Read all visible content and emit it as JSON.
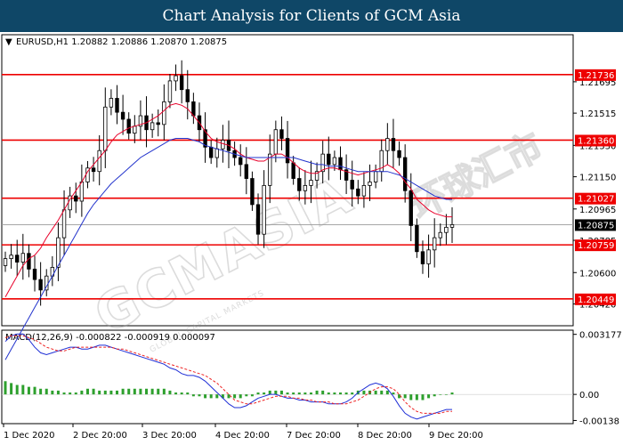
{
  "banner": {
    "title": "Chart Analysis for Clients of GCM Asia",
    "bg_color": "#0f4767"
  },
  "watermark": {
    "text": "GCMASIA",
    "cn_text": "环球汇市",
    "small": "GLOBAL CAPITAL MARKETS"
  },
  "chart_data": {
    "type": "candlestick",
    "symbol_header": "EURUSD,H1  1.20882 1.20886 1.20870 1.20875",
    "price_axis": {
      "range": [
        1.203,
        1.2196
      ],
      "ticks": [
        "1.21695",
        "1.21515",
        "1.21330",
        "1.21150",
        "1.20965",
        "1.20785",
        "1.20600",
        "1.20420"
      ],
      "tick_values": [
        1.21695,
        1.21515,
        1.2133,
        1.2115,
        1.20965,
        1.20785,
        1.206,
        1.2042
      ]
    },
    "x_axis_labels": [
      "1 Dec 2020",
      "2 Dec 20:00",
      "3 Dec 20:00",
      "4 Dec 20:00",
      "7 Dec 20:00",
      "8 Dec 20:00",
      "9 Dec 20:00"
    ],
    "current_price": {
      "value": 1.20875,
      "label": "1.20875"
    },
    "levels": [
      {
        "value": 1.21736,
        "label": "1.21736"
      },
      {
        "value": 1.2136,
        "label": "1.21360"
      },
      {
        "value": 1.21027,
        "label": "1.21027"
      },
      {
        "value": 1.20759,
        "label": "1.20759"
      },
      {
        "value": 1.20449,
        "label": "1.20449"
      }
    ],
    "closes": [
      1.2068,
      1.207,
      1.2066,
      1.2071,
      1.2062,
      1.2056,
      1.205,
      1.2058,
      1.2063,
      1.208,
      1.2096,
      1.2104,
      1.2101,
      1.2112,
      1.212,
      1.2118,
      1.213,
      1.2155,
      1.216,
      1.2152,
      1.2148,
      1.214,
      1.2144,
      1.215,
      1.2142,
      1.2146,
      1.2145,
      1.2158,
      1.217,
      1.2173,
      1.2165,
      1.2158,
      1.215,
      1.2142,
      1.2132,
      1.2126,
      1.2131,
      1.2136,
      1.213,
      1.2126,
      1.2122,
      1.2114,
      1.2099,
      1.2082,
      1.211,
      1.2128,
      1.2142,
      1.2137,
      1.2123,
      1.2114,
      1.2107,
      1.211,
      1.2113,
      1.2118,
      1.2128,
      1.2122,
      1.2126,
      1.2119,
      1.2113,
      1.2108,
      1.2104,
      1.211,
      1.2112,
      1.2118,
      1.213,
      1.2137,
      1.213,
      1.2126,
      1.2107,
      1.2087,
      1.2072,
      1.2065,
      1.2073,
      1.208,
      1.2083,
      1.2086,
      1.20875
    ],
    "sma_red": [
      1.2046,
      1.2052,
      1.2058,
      1.2064,
      1.2068,
      1.207,
      1.2074,
      1.208,
      1.2085,
      1.209,
      1.2096,
      1.2102,
      1.2107,
      1.2112,
      1.2118,
      1.2122,
      1.2126,
      1.213,
      1.2135,
      1.2139,
      1.2141,
      1.2143,
      1.2144,
      1.2145,
      1.2146,
      1.2148,
      1.215,
      1.2153,
      1.2156,
      1.2157,
      1.2156,
      1.2154,
      1.215,
      1.2146,
      1.2141,
      1.2137,
      1.2135,
      1.2134,
      1.2133,
      1.2131,
      1.2128,
      1.2126,
      1.2125,
      1.2124,
      1.2124,
      1.2126,
      1.2128,
      1.2128,
      1.2126,
      1.2123,
      1.212,
      1.2118,
      1.2117,
      1.2117,
      1.2119,
      1.212,
      1.212,
      1.2119,
      1.2118,
      1.2117,
      1.2116,
      1.2117,
      1.2118,
      1.2119,
      1.212,
      1.2122,
      1.212,
      1.2117,
      1.2112,
      1.2108,
      1.2102,
      1.2099,
      1.2096,
      1.2094,
      1.2093,
      1.2092,
      1.2092
    ],
    "sma_blue": [
      1.201,
      1.2016,
      1.2022,
      1.2028,
      1.2034,
      1.204,
      1.2046,
      1.2052,
      1.2058,
      1.2064,
      1.207,
      1.2076,
      1.2082,
      1.2088,
      1.2094,
      1.2099,
      1.2103,
      1.2107,
      1.2111,
      1.2114,
      1.2117,
      1.212,
      1.2123,
      1.2126,
      1.2128,
      1.213,
      1.2132,
      1.2134,
      1.2136,
      1.2137,
      1.2137,
      1.2137,
      1.2136,
      1.2135,
      1.2133,
      1.2132,
      1.2131,
      1.213,
      1.2129,
      1.2128,
      1.2127,
      1.2126,
      1.2126,
      1.2126,
      1.2126,
      1.2126,
      1.2126,
      1.2126,
      1.2126,
      1.2126,
      1.2125,
      1.2124,
      1.2123,
      1.2122,
      1.2122,
      1.2121,
      1.2121,
      1.2121,
      1.212,
      1.2119,
      1.2118,
      1.2118,
      1.2118,
      1.2118,
      1.2118,
      1.2118,
      1.2117,
      1.2116,
      1.2114,
      1.2112,
      1.211,
      1.2108,
      1.2106,
      1.2104,
      1.2103,
      1.2102,
      1.2102
    ],
    "macd": {
      "header": "MACD(12,26,9) -0.000822 -0.000919 0.000097",
      "range": [
        -0.0015,
        0.00335
      ],
      "ticks": [
        "0.003177",
        "0.00",
        "-0.00138"
      ],
      "tick_values": [
        0.003177,
        0.0,
        -0.00138
      ],
      "main": [
        0.0028,
        0.0031,
        0.0032,
        0.0032,
        0.0029,
        0.0025,
        0.0022,
        0.0021,
        0.0022,
        0.0023,
        0.0024,
        0.0025,
        0.0025,
        0.0024,
        0.0024,
        0.0025,
        0.0026,
        0.0026,
        0.0025,
        0.0024,
        0.0023,
        0.0022,
        0.0021,
        0.002,
        0.0019,
        0.0018,
        0.0017,
        0.0016,
        0.0014,
        0.0013,
        0.0011,
        0.001,
        0.001,
        0.0009,
        0.0007,
        0.0004,
        0.0001,
        -0.0002,
        -0.0005,
        -0.0007,
        -0.0007,
        -0.0006,
        -0.0004,
        -0.0002,
        -0.0001,
        0.0,
        0.0,
        -0.0001,
        -0.0002,
        -0.0002,
        -0.0003,
        -0.0003,
        -0.0004,
        -0.0004,
        -0.0004,
        -0.0005,
        -0.0005,
        -0.0005,
        -0.0004,
        -0.0002,
        0.0001,
        0.0003,
        0.0005,
        0.0006,
        0.0005,
        0.0003,
        -0.0001,
        -0.0006,
        -0.001,
        -0.0012,
        -0.0013,
        -0.0012,
        -0.0011,
        -0.001,
        -0.0009,
        -0.0008,
        -0.0008
      ],
      "signal": [
        0.003,
        0.0031,
        0.0031,
        0.0031,
        0.003,
        0.0029,
        0.0027,
        0.0025,
        0.0024,
        0.0023,
        0.0023,
        0.0024,
        0.0025,
        0.0025,
        0.0025,
        0.0025,
        0.0025,
        0.0025,
        0.0025,
        0.0024,
        0.0024,
        0.0023,
        0.0022,
        0.0021,
        0.002,
        0.0019,
        0.0018,
        0.0017,
        0.0016,
        0.0015,
        0.0014,
        0.0013,
        0.0012,
        0.0011,
        0.001,
        0.0008,
        0.0006,
        0.0003,
        0.0,
        -0.0003,
        -0.0004,
        -0.0005,
        -0.0005,
        -0.0004,
        -0.0003,
        -0.0002,
        -0.0001,
        -0.0001,
        -0.0001,
        -0.0002,
        -0.0002,
        -0.0003,
        -0.0003,
        -0.0004,
        -0.0004,
        -0.0004,
        -0.0005,
        -0.0005,
        -0.0005,
        -0.0004,
        -0.0003,
        -0.0001,
        0.0001,
        0.0003,
        0.0004,
        0.0004,
        0.0003,
        0.0,
        -0.0004,
        -0.0007,
        -0.0009,
        -0.001,
        -0.001,
        -0.001,
        -0.001,
        -0.0009,
        -0.0009
      ],
      "histogram": [
        0.0007,
        0.0006,
        0.0005,
        0.0005,
        0.0004,
        0.0004,
        0.0003,
        0.0003,
        0.0002,
        0.0002,
        0.0001,
        0.0001,
        0.0001,
        0.0002,
        0.0003,
        0.0003,
        0.0002,
        0.0002,
        0.0002,
        0.0002,
        0.0003,
        0.0003,
        0.0003,
        0.0003,
        0.0003,
        0.0003,
        0.0003,
        0.0003,
        0.0002,
        0.0001,
        0.0001,
        0.0001,
        -0.0001,
        -0.0001,
        -0.0002,
        -0.0002,
        -0.0002,
        -0.0002,
        -0.0002,
        -0.0002,
        -0.0002,
        -0.0001,
        -0.0001,
        0.0001,
        0.0001,
        0.0002,
        0.0002,
        0.0002,
        0.0001,
        0.0001,
        0.0001,
        0.0001,
        0.0001,
        0.0002,
        0.0002,
        0.0001,
        0.0001,
        0.0001,
        0.0001,
        0.0001,
        0.0002,
        0.0002,
        0.0002,
        0.0002,
        0.0002,
        0.0002,
        0.0001,
        -0.0002,
        -0.0002,
        -0.0003,
        -0.0003,
        -0.0003,
        -0.0002,
        -0.0001,
        0.0,
        0.0,
        0.0001
      ]
    }
  },
  "colors": {
    "level_line": "#ee0000",
    "bull_candle": "#ffffff",
    "bear_candle": "#000000",
    "sma_red": "#e8002a",
    "sma_blue": "#2233cc",
    "macd_main": "#1f2fd6",
    "macd_signal": "#ee2222",
    "macd_hist": "#2ea02e"
  }
}
